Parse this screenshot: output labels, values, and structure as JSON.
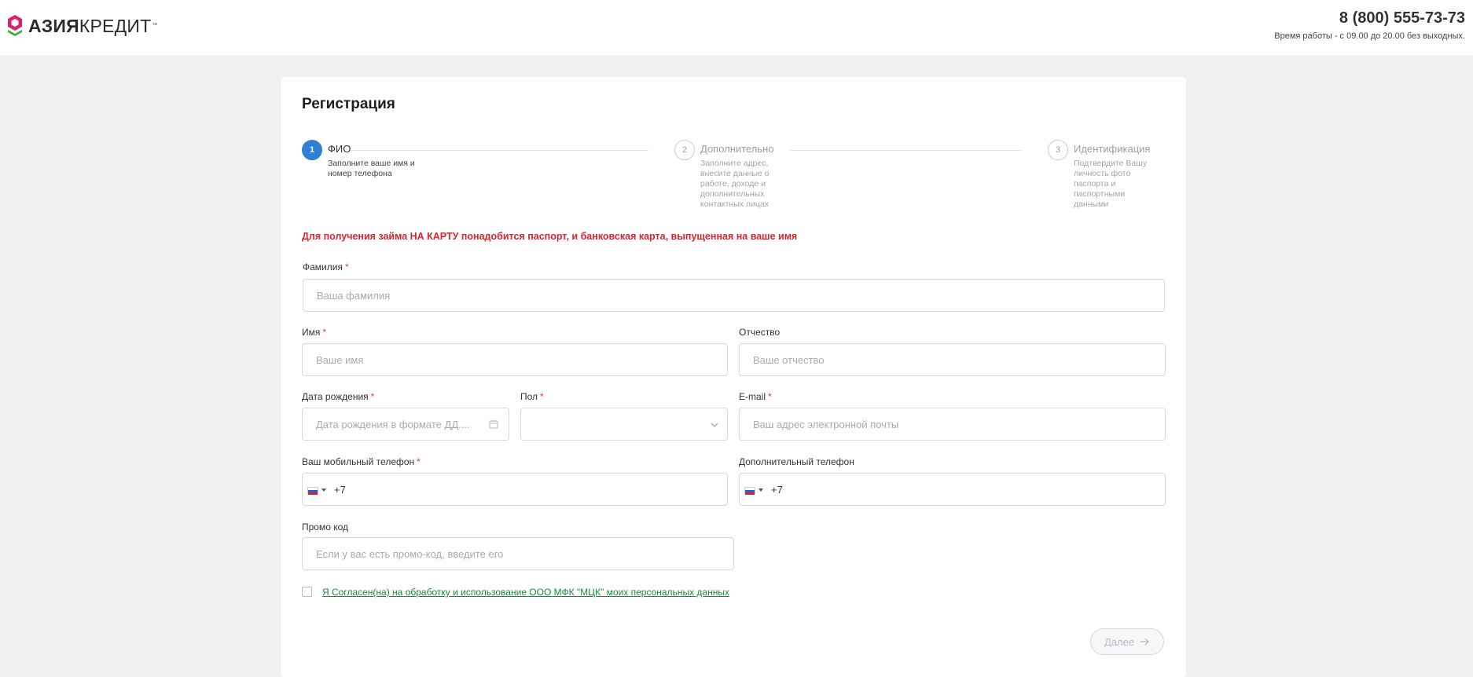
{
  "header": {
    "logo_bold": "АЗИЯ",
    "logo_light": "КРЕДИТ",
    "logo_tm": "™",
    "phone": "8 (800) 555-73-73",
    "hours": "Время работы - с 09.00 до 20.00 без выходных."
  },
  "page": {
    "title": "Регистрация",
    "notice": "Для получения займа НА КАРТУ понадобится паспорт, и банковская карта, выпущенная на ваше имя"
  },
  "steps": [
    {
      "number": "1",
      "title": "ФИО",
      "desc": "Заполните ваше имя и номер телефона",
      "active": true
    },
    {
      "number": "2",
      "title": "Дополнительно",
      "desc": "Заполните адрес, внесите данные о работе, доходе и дополнительных контактных лицах",
      "active": false
    },
    {
      "number": "3",
      "title": "Идентификация",
      "desc": "Подтвердите Вашу личность фото паспорта и паспортными данными",
      "active": false
    }
  ],
  "form": {
    "required_mark": "*",
    "surname": {
      "label": "Фамилия",
      "placeholder": "Ваша фамилия"
    },
    "name": {
      "label": "Имя",
      "placeholder": "Ваше имя"
    },
    "patronymic": {
      "label": "Отчество",
      "placeholder": "Ваше отчество"
    },
    "birthdate": {
      "label": "Дата рождения",
      "placeholder": "Дата рождения в формате ДД...."
    },
    "gender": {
      "label": "Пол",
      "value": ""
    },
    "email": {
      "label": "E-mail",
      "placeholder": "Ваш адрес электронной почты"
    },
    "mobile": {
      "label": "Ваш мобильный телефон",
      "value": "+7"
    },
    "extra_phone": {
      "label": "Дополнительный телефон",
      "value": "+7"
    },
    "promo": {
      "label": "Промо код",
      "placeholder": "Если у вас есть промо-код, введите его"
    },
    "consent": "Я Согласен(на) на обработку и использование ООО МФК \"МЦК\" моих персональных данных",
    "next_label": "Далее"
  },
  "colors": {
    "accent_blue": "#2f7fd6",
    "notice_red": "#d7262e",
    "consent_green": "#1b8a3a",
    "logo_pink": "#d6246e",
    "logo_green": "#3aaa35"
  },
  "icons": [
    "logo-mark-icon",
    "calendar-icon",
    "chevron-down-icon",
    "russia-flag-icon",
    "arrow-right-icon"
  ]
}
